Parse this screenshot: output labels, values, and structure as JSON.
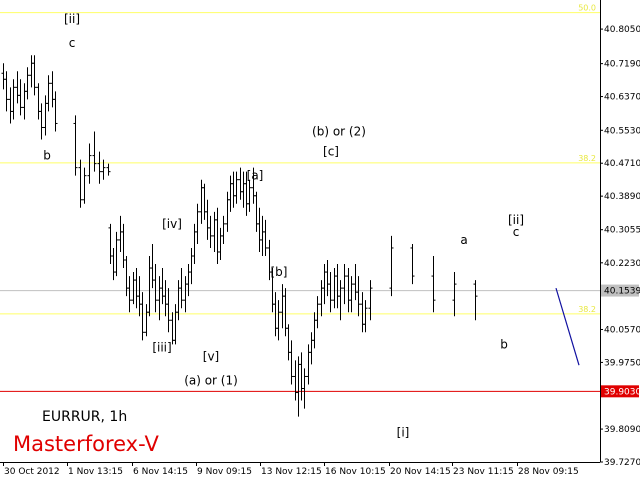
{
  "chart_data": {
    "type": "bar",
    "title": "EURRUR, 1h",
    "watermark": "Masterforex-V",
    "symbol": "EURRUR",
    "timeframe": "1h",
    "xlabel": "",
    "ylabel": "",
    "ylim": [
      39.727,
      40.9
    ],
    "grid": false,
    "colors": {
      "background": "#ffffff",
      "bars": "#000000",
      "support": "#e00000",
      "fibo": "#ffff66",
      "current": "#c0c0c0",
      "forecast": "#1010a0",
      "watermark": "#e00000"
    },
    "x_ticks": [
      "30 Oct 2012",
      "1 Nov 13:15",
      "6 Nov 14:15",
      "9 Nov 09:15",
      "13 Nov 12:15",
      "16 Nov 10:15",
      "20 Nov 14:15",
      "23 Nov 11:15",
      "28 Nov 09:15"
    ],
    "y_ticks": [
      "40.8050",
      "40.7190",
      "40.6370",
      "40.5530",
      "40.4710",
      "40.3890",
      "40.3055",
      "40.2230",
      "40.0570",
      "39.9750",
      "39.8090",
      "39.7270"
    ],
    "current_price": {
      "label": "40.1539",
      "value": 40.1539
    },
    "support": {
      "label": "39.9030",
      "value": 39.903
    },
    "fibo_levels": [
      {
        "label": "50.0",
        "value": 40.846
      },
      {
        "label": "38.2",
        "value": 40.472
      },
      {
        "label": "38.2",
        "value": 40.096
      }
    ],
    "forecast": {
      "from": 40.16,
      "to": 39.968
    },
    "ohlc": [
      [
        40.695,
        40.72,
        40.655,
        40.68
      ],
      [
        40.68,
        40.7,
        40.6,
        40.63
      ],
      [
        40.63,
        40.66,
        40.57,
        40.6
      ],
      [
        40.6,
        40.68,
        40.58,
        40.66
      ],
      [
        40.66,
        40.7,
        40.62,
        40.64
      ],
      [
        40.64,
        40.68,
        40.59,
        40.61
      ],
      [
        40.61,
        40.67,
        40.58,
        40.65
      ],
      [
        40.65,
        40.71,
        40.63,
        40.69
      ],
      [
        40.69,
        40.74,
        40.66,
        40.72
      ],
      [
        40.72,
        40.74,
        40.64,
        40.66
      ],
      [
        40.66,
        40.67,
        40.58,
        40.6
      ],
      [
        40.6,
        40.62,
        40.53,
        40.56
      ],
      [
        40.56,
        40.64,
        40.54,
        40.62
      ],
      [
        40.62,
        40.69,
        40.6,
        40.67
      ],
      [
        40.67,
        40.7,
        40.61,
        40.63
      ],
      [
        40.63,
        40.65,
        40.55,
        40.57
      ],
      [
        40.57,
        40.59,
        40.44,
        40.46
      ],
      [
        40.46,
        40.48,
        40.36,
        40.38
      ],
      [
        40.38,
        40.46,
        40.37,
        40.44
      ],
      [
        40.44,
        40.52,
        40.42,
        40.49
      ],
      [
        40.49,
        40.55,
        40.45,
        40.47
      ],
      [
        40.47,
        40.5,
        40.42,
        40.45
      ],
      [
        40.45,
        40.48,
        40.43,
        40.46
      ],
      [
        40.46,
        40.47,
        40.44,
        40.45
      ],
      [
        40.31,
        40.32,
        40.22,
        40.24
      ],
      [
        40.24,
        40.26,
        40.18,
        40.2
      ],
      [
        40.2,
        40.3,
        40.19,
        40.28
      ],
      [
        40.28,
        40.34,
        40.25,
        40.3
      ],
      [
        40.3,
        40.32,
        40.21,
        40.23
      ],
      [
        40.23,
        40.24,
        40.14,
        40.16
      ],
      [
        40.16,
        40.19,
        40.1,
        40.13
      ],
      [
        40.13,
        40.2,
        40.12,
        40.18
      ],
      [
        40.18,
        40.21,
        40.11,
        40.14
      ],
      [
        40.14,
        40.19,
        40.09,
        40.12
      ],
      [
        40.12,
        40.15,
        40.03,
        40.05
      ],
      [
        40.05,
        40.12,
        40.04,
        40.1
      ],
      [
        40.1,
        40.24,
        40.09,
        40.21
      ],
      [
        40.21,
        40.27,
        40.16,
        40.18
      ],
      [
        40.18,
        40.22,
        40.1,
        40.13
      ],
      [
        40.13,
        40.19,
        40.08,
        40.16
      ],
      [
        40.16,
        40.21,
        40.12,
        40.14
      ],
      [
        40.14,
        40.18,
        40.09,
        40.12
      ],
      [
        40.12,
        40.16,
        40.05,
        40.08
      ],
      [
        40.08,
        40.1,
        40.02,
        40.03
      ],
      [
        40.03,
        40.12,
        40.02,
        40.1
      ],
      [
        40.1,
        40.18,
        40.08,
        40.16
      ],
      [
        40.16,
        40.21,
        40.11,
        40.13
      ],
      [
        40.13,
        40.19,
        40.1,
        40.17
      ],
      [
        40.17,
        40.22,
        40.14,
        40.2
      ],
      [
        40.2,
        40.26,
        40.17,
        40.24
      ],
      [
        40.24,
        40.32,
        40.22,
        40.3
      ],
      [
        40.3,
        40.37,
        40.27,
        40.35
      ],
      [
        40.35,
        40.43,
        40.32,
        40.41
      ],
      [
        40.41,
        40.42,
        40.33,
        40.35
      ],
      [
        40.35,
        40.38,
        40.28,
        40.31
      ],
      [
        40.31,
        40.34,
        40.26,
        40.29
      ],
      [
        40.29,
        40.35,
        40.25,
        40.33
      ],
      [
        40.33,
        40.36,
        40.22,
        40.25
      ],
      [
        40.25,
        40.31,
        40.23,
        40.29
      ],
      [
        40.29,
        40.34,
        40.27,
        40.32
      ],
      [
        40.32,
        40.4,
        40.3,
        40.38
      ],
      [
        40.38,
        40.44,
        40.35,
        40.42
      ],
      [
        40.42,
        40.45,
        40.36,
        40.39
      ],
      [
        40.39,
        40.45,
        40.37,
        40.43
      ],
      [
        40.43,
        40.46,
        40.38,
        40.4
      ],
      [
        40.4,
        40.45,
        40.36,
        40.42
      ],
      [
        40.42,
        40.45,
        40.34,
        40.37
      ],
      [
        40.37,
        40.43,
        40.35,
        40.41
      ],
      [
        40.41,
        40.46,
        40.37,
        40.39
      ],
      [
        40.39,
        40.4,
        40.3,
        40.32
      ],
      [
        40.32,
        40.36,
        40.25,
        40.28
      ],
      [
        40.28,
        40.34,
        40.24,
        40.3
      ],
      [
        40.3,
        40.33,
        40.24,
        40.26
      ],
      [
        40.26,
        40.28,
        40.18,
        40.2
      ],
      [
        40.2,
        40.21,
        40.1,
        40.12
      ],
      [
        40.12,
        40.15,
        40.04,
        40.06
      ],
      [
        40.06,
        40.13,
        40.03,
        40.1
      ],
      [
        40.1,
        40.17,
        40.06,
        40.14
      ],
      [
        40.14,
        40.16,
        40.04,
        40.06
      ],
      [
        40.06,
        40.07,
        39.98,
        40.0
      ],
      [
        40.0,
        40.03,
        39.92,
        39.94
      ],
      [
        39.94,
        39.98,
        39.88,
        39.9
      ],
      [
        39.9,
        39.99,
        39.84,
        39.97
      ],
      [
        39.97,
        40.0,
        39.88,
        39.91
      ],
      [
        39.91,
        39.96,
        39.86,
        39.94
      ],
      [
        39.94,
        40.02,
        39.92,
        40.0
      ],
      [
        40.0,
        40.05,
        39.97,
        40.03
      ],
      [
        40.03,
        40.1,
        40.01,
        40.08
      ],
      [
        40.08,
        40.14,
        40.06,
        40.12
      ],
      [
        40.12,
        40.18,
        40.09,
        40.16
      ],
      [
        40.16,
        40.22,
        40.12,
        40.2
      ],
      [
        40.2,
        40.23,
        40.14,
        40.17
      ],
      [
        40.17,
        40.2,
        40.1,
        40.13
      ],
      [
        40.13,
        40.21,
        40.11,
        40.19
      ],
      [
        40.19,
        40.22,
        40.11,
        40.14
      ],
      [
        40.14,
        40.18,
        40.08,
        40.16
      ],
      [
        40.16,
        40.22,
        40.12,
        40.19
      ],
      [
        40.19,
        40.21,
        40.1,
        40.13
      ],
      [
        40.13,
        40.19,
        40.1,
        40.17
      ],
      [
        40.17,
        40.22,
        40.13,
        40.15
      ],
      [
        40.15,
        40.19,
        40.09,
        40.12
      ],
      [
        40.12,
        40.15,
        40.05,
        40.07
      ],
      [
        40.07,
        40.13,
        40.05,
        40.11
      ],
      [
        40.11,
        40.18,
        40.08,
        40.16
      ],
      [
        40.16,
        40.29,
        40.14,
        40.26
      ],
      [
        40.26,
        40.27,
        40.17,
        40.19
      ],
      [
        40.19,
        40.24,
        40.1,
        40.13
      ],
      [
        40.13,
        40.2,
        40.09,
        40.17
      ],
      [
        40.17,
        40.18,
        40.08,
        40.14
      ]
    ],
    "annotations": [
      {
        "text": "[ii]",
        "x": 1,
        "y": 40.82
      },
      {
        "text": "c",
        "x": 1,
        "y": 40.76
      },
      {
        "text": "b",
        "x": 2,
        "y": 40.48
      },
      {
        "text": "[iv]",
        "x": 6,
        "y": 40.31
      },
      {
        "text": "[iii]",
        "x": 6,
        "y": 40.002
      },
      {
        "text": "[v]",
        "x": 10,
        "y": 39.98
      },
      {
        "text": "(a) or (1)",
        "x": 11,
        "y": 39.92
      },
      {
        "text": "[a]",
        "x": 14,
        "y": 40.43
      },
      {
        "text": "[b]",
        "x": 14,
        "y": 40.19
      },
      {
        "text": "(b) or (2)",
        "x": 17,
        "y": 40.54
      },
      {
        "text": "[c]",
        "x": 18,
        "y": 40.49
      },
      {
        "text": "[i]",
        "x": 24,
        "y": 39.79
      },
      {
        "text": "a",
        "x": 27,
        "y": 40.27
      },
      {
        "text": "b",
        "x": 28,
        "y": 40.01
      },
      {
        "text": "[ii]",
        "x": 29,
        "y": 40.32
      },
      {
        "text": "c",
        "x": 29,
        "y": 40.29
      }
    ]
  }
}
